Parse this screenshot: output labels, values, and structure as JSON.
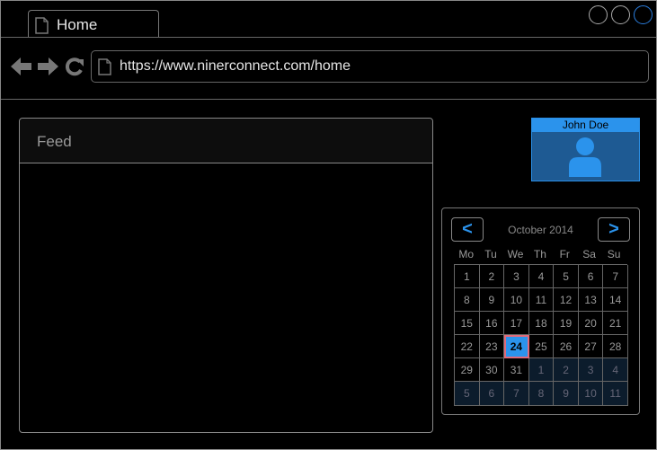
{
  "tab": {
    "label": "Home"
  },
  "address_bar": {
    "url": "https://www.ninerconnect.com/home"
  },
  "feed": {
    "title": "Feed"
  },
  "user": {
    "name": "John Doe"
  },
  "calendar": {
    "month_label": "October 2014",
    "prev_label": "<",
    "next_label": ">",
    "weekdays": [
      "Mo",
      "Tu",
      "We",
      "Th",
      "Fr",
      "Sa",
      "Su"
    ],
    "selected_day": "24",
    "days": [
      {
        "d": "1"
      },
      {
        "d": "2"
      },
      {
        "d": "3"
      },
      {
        "d": "4"
      },
      {
        "d": "5"
      },
      {
        "d": "6"
      },
      {
        "d": "7"
      },
      {
        "d": "8"
      },
      {
        "d": "9"
      },
      {
        "d": "10"
      },
      {
        "d": "11"
      },
      {
        "d": "12"
      },
      {
        "d": "13"
      },
      {
        "d": "14"
      },
      {
        "d": "15"
      },
      {
        "d": "16"
      },
      {
        "d": "17"
      },
      {
        "d": "18"
      },
      {
        "d": "19"
      },
      {
        "d": "20"
      },
      {
        "d": "21"
      },
      {
        "d": "22"
      },
      {
        "d": "23"
      },
      {
        "d": "24",
        "today": true
      },
      {
        "d": "25"
      },
      {
        "d": "26"
      },
      {
        "d": "27"
      },
      {
        "d": "28"
      },
      {
        "d": "29"
      },
      {
        "d": "30"
      },
      {
        "d": "31"
      },
      {
        "d": "1",
        "other": true
      },
      {
        "d": "2",
        "other": true
      },
      {
        "d": "3",
        "other": true
      },
      {
        "d": "4",
        "other": true
      },
      {
        "d": "5",
        "other": true
      },
      {
        "d": "6",
        "other": true
      },
      {
        "d": "7",
        "other": true
      },
      {
        "d": "8",
        "other": true
      },
      {
        "d": "9",
        "other": true
      },
      {
        "d": "10",
        "other": true
      },
      {
        "d": "11",
        "other": true
      }
    ]
  },
  "colors": {
    "accent": "#2b93ec",
    "today_outline": "#e06a7a",
    "user_card_bg": "#1e5a93"
  }
}
